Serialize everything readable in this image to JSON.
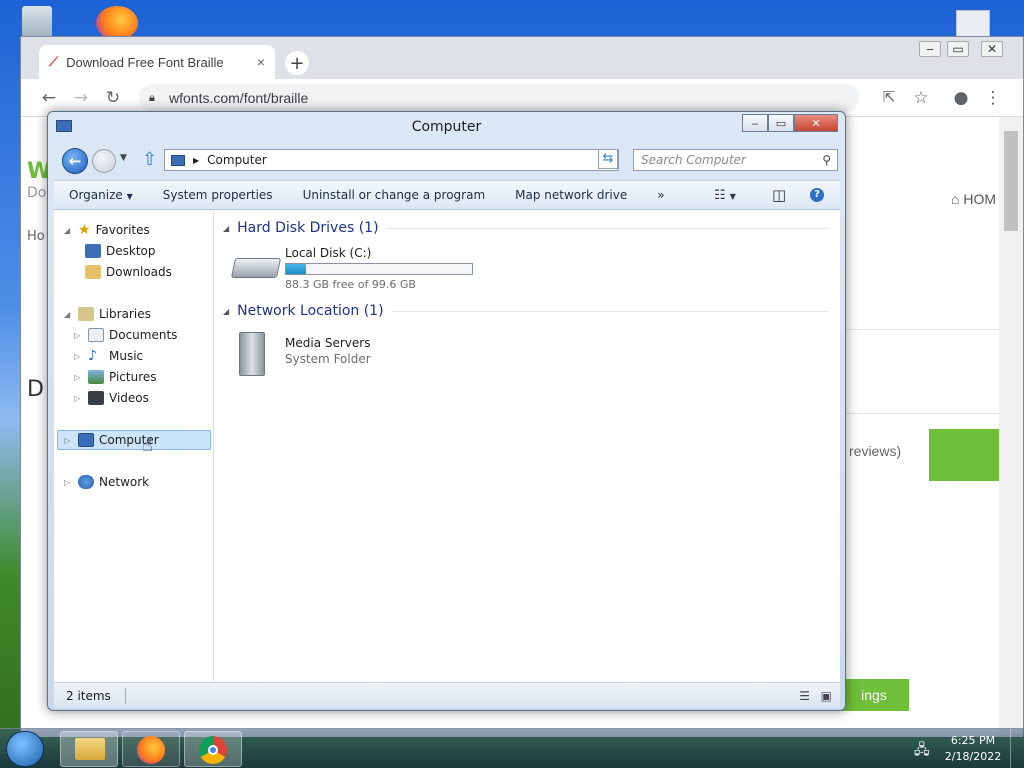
{
  "browser": {
    "tab_title": "Download Free Font Braille",
    "tab_close": "×",
    "new_tab": "+",
    "url": "wfonts.com/font/braille",
    "page_fragments": {
      "home_nav": "HOM",
      "reviews": "reviews)",
      "settings_btn": "ings",
      "left_w": "W",
      "left_do": "Do",
      "left_ho": "Ho",
      "left_d": "D"
    }
  },
  "explorer": {
    "title": "Computer",
    "address": "Computer",
    "search_placeholder": "Search Computer",
    "commands": [
      "Organize",
      "System properties",
      "Uninstall or change a program",
      "Map network drive"
    ],
    "more": "»",
    "nav": {
      "favorites": "Favorites",
      "desktop": "Desktop",
      "downloads": "Downloads",
      "libraries": "Libraries",
      "documents": "Documents",
      "music": "Music",
      "pictures": "Pictures",
      "videos": "Videos",
      "computer": "Computer",
      "network": "Network"
    },
    "groups": {
      "hdd": "Hard Disk Drives (1)",
      "network": "Network Location (1)"
    },
    "drive": {
      "name": "Local Disk (C:)",
      "free_text": "88.3 GB free of 99.6 GB",
      "used_fraction": 0.11
    },
    "media": {
      "name": "Media Servers",
      "type": "System Folder"
    },
    "status": "2 items"
  },
  "taskbar": {
    "time": "6:25 PM",
    "date": "2/18/2022"
  }
}
